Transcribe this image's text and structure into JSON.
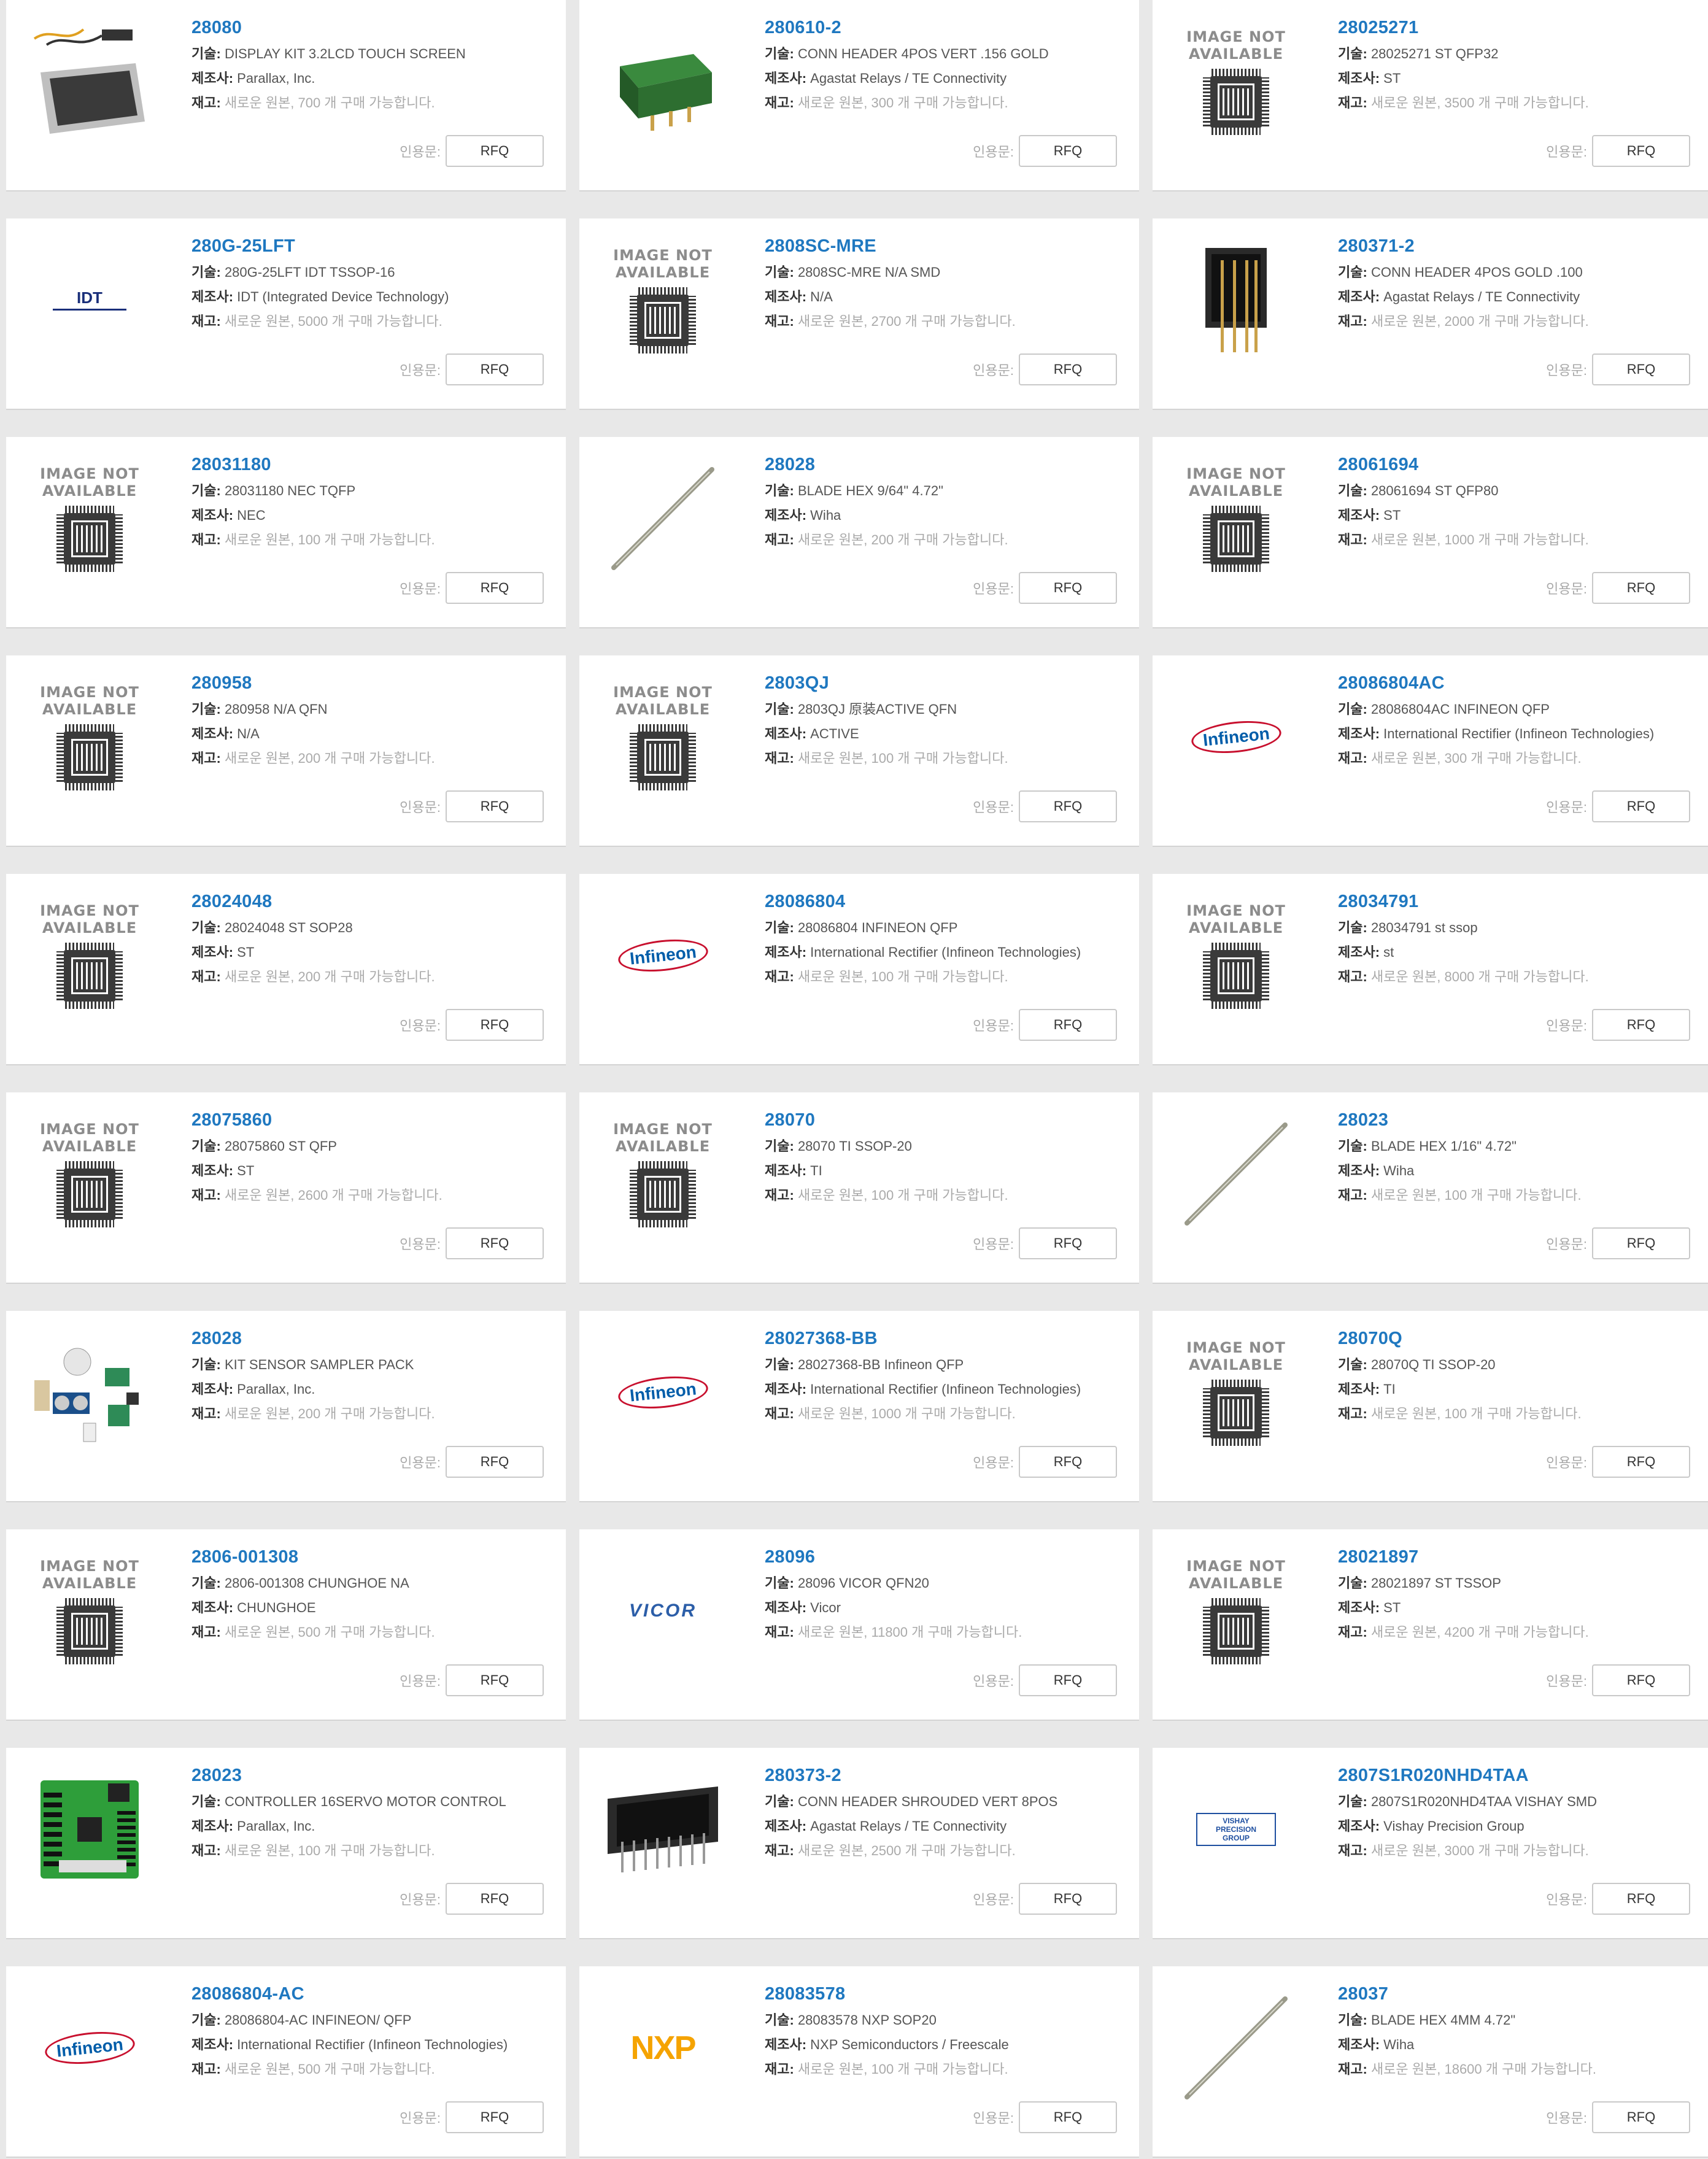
{
  "labels": {
    "desc": "기술:",
    "mfr": "제조사:",
    "stock": "재고:",
    "quote": "인용문:",
    "rfq": "RFQ",
    "na_top": "IMAGE NOT",
    "na_bottom": "AVAILABLE"
  },
  "products": [
    {
      "pn": "28080",
      "desc": "DISPLAY KIT 3.2LCD TOUCH SCREEN",
      "mfr": "Parallax, Inc.",
      "stock": "새로운 원본, 700 개 구매 가능합니다.",
      "thumb": "lcd-kit"
    },
    {
      "pn": "280610-2",
      "desc": "CONN HEADER 4POS VERT .156 GOLD",
      "mfr": "Agastat Relays / TE Connectivity",
      "stock": "새로운 원본, 300 개 구매 가능합니다.",
      "thumb": "green-header"
    },
    {
      "pn": "28025271",
      "desc": "28025271 ST QFP32",
      "mfr": "ST",
      "stock": "새로운 원본, 3500 개 구매 가능합니다.",
      "thumb": "na"
    },
    {
      "pn": "280G-25LFT",
      "desc": "280G-25LFT IDT TSSOP-16",
      "mfr": "IDT (Integrated Device Technology)",
      "stock": "새로운 원본, 5000 개 구매 가능합니다.",
      "thumb": "idt",
      "brand": "IDT"
    },
    {
      "pn": "2808SC-MRE",
      "desc": "2808SC-MRE N/A SMD",
      "mfr": "N/A",
      "stock": "새로운 원본, 2700 개 구매 가능합니다.",
      "thumb": "na"
    },
    {
      "pn": "280371-2",
      "desc": "CONN HEADER 4POS GOLD .100",
      "mfr": "Agastat Relays / TE Connectivity",
      "stock": "새로운 원본, 2000 개 구매 가능합니다.",
      "thumb": "black-header"
    },
    {
      "pn": "28031180",
      "desc": "28031180 NEC TQFP",
      "mfr": "NEC",
      "stock": "새로운 원본, 100 개 구매 가능합니다.",
      "thumb": "na"
    },
    {
      "pn": "28028",
      "desc": "BLADE HEX 9/64\" 4.72\"",
      "mfr": "Wiha",
      "stock": "새로운 원본, 200 개 구매 가능합니다.",
      "thumb": "blade"
    },
    {
      "pn": "28061694",
      "desc": "28061694 ST QFP80",
      "mfr": "ST",
      "stock": "새로운 원본, 1000 개 구매 가능합니다.",
      "thumb": "na"
    },
    {
      "pn": "280958",
      "desc": "280958 N/A QFN",
      "mfr": "N/A",
      "stock": "새로운 원본, 200 개 구매 가능합니다.",
      "thumb": "na"
    },
    {
      "pn": "2803QJ",
      "desc": "2803QJ 原装ACTIVE QFN",
      "mfr": "ACTIVE",
      "stock": "새로운 원본, 100 개 구매 가능합니다.",
      "thumb": "na"
    },
    {
      "pn": "28086804AC",
      "desc": "28086804AC INFINEON QFP",
      "mfr": "International Rectifier (Infineon Technologies)",
      "stock": "새로운 원본, 300 개 구매 가능합니다.",
      "thumb": "infineon",
      "brand": "Infineon"
    },
    {
      "pn": "28024048",
      "desc": "28024048 ST SOP28",
      "mfr": "ST",
      "stock": "새로운 원본, 200 개 구매 가능합니다.",
      "thumb": "na"
    },
    {
      "pn": "28086804",
      "desc": "28086804 INFINEON QFP",
      "mfr": "International Rectifier (Infineon Technologies)",
      "stock": "새로운 원본, 100 개 구매 가능합니다.",
      "thumb": "infineon",
      "brand": "Infineon"
    },
    {
      "pn": "28034791",
      "desc": "28034791 st ssop",
      "mfr": "st",
      "stock": "새로운 원본, 8000 개 구매 가능합니다.",
      "thumb": "na"
    },
    {
      "pn": "28075860",
      "desc": "28075860 ST QFP",
      "mfr": "ST",
      "stock": "새로운 원본, 2600 개 구매 가능합니다.",
      "thumb": "na"
    },
    {
      "pn": "28070",
      "desc": "28070 TI SSOP-20",
      "mfr": "TI",
      "stock": "새로운 원본, 100 개 구매 가능합니다.",
      "thumb": "na"
    },
    {
      "pn": "28023",
      "desc": "BLADE HEX 1/16\" 4.72\"",
      "mfr": "Wiha",
      "stock": "새로운 원본, 100 개 구매 가능합니다.",
      "thumb": "blade"
    },
    {
      "pn": "28028",
      "desc": "KIT SENSOR SAMPLER PACK",
      "mfr": "Parallax, Inc.",
      "stock": "새로운 원본, 200 개 구매 가능합니다.",
      "thumb": "sensor-kit"
    },
    {
      "pn": "28027368-BB",
      "desc": "28027368-BB Infineon QFP",
      "mfr": "International Rectifier (Infineon Technologies)",
      "stock": "새로운 원본, 1000 개 구매 가능합니다.",
      "thumb": "infineon",
      "brand": "Infineon"
    },
    {
      "pn": "28070Q",
      "desc": "28070Q TI SSOP-20",
      "mfr": "TI",
      "stock": "새로운 원본, 100 개 구매 가능합니다.",
      "thumb": "na"
    },
    {
      "pn": "2806-001308",
      "desc": "2806-001308 CHUNGHOE NA",
      "mfr": "CHUNGHOE",
      "stock": "새로운 원본, 500 개 구매 가능합니다.",
      "thumb": "na"
    },
    {
      "pn": "28096",
      "desc": "28096 VICOR QFN20",
      "mfr": "Vicor",
      "stock": "새로운 원본, 11800 개 구매 가능합니다.",
      "thumb": "vicor",
      "brand": "VICOR"
    },
    {
      "pn": "28021897",
      "desc": "28021897 ST TSSOP",
      "mfr": "ST",
      "stock": "새로운 원본, 4200 개 구매 가능합니다.",
      "thumb": "na"
    },
    {
      "pn": "28023",
      "desc": "CONTROLLER 16SERVO MOTOR CONTROL",
      "mfr": "Parallax, Inc.",
      "stock": "새로운 원본, 100 개 구매 가능합니다.",
      "thumb": "pcb"
    },
    {
      "pn": "280373-2",
      "desc": "CONN HEADER SHROUDED VERT 8POS",
      "mfr": "Agastat Relays / TE Connectivity",
      "stock": "새로운 원본, 2500 개 구매 가능합니다.",
      "thumb": "shrouded-header"
    },
    {
      "pn": "2807S1R020NHD4TAA",
      "desc": "2807S1R020NHD4TAA VISHAY SMD",
      "mfr": "Vishay Precision Group",
      "stock": "새로운 원본, 3000 개 구매 가능합니다.",
      "thumb": "vishay",
      "brand": "VISHAY PRECISION GROUP"
    },
    {
      "pn": "28086804-AC",
      "desc": "28086804-AC INFINEON/ QFP",
      "mfr": "International Rectifier (Infineon Technologies)",
      "stock": "새로운 원본, 500 개 구매 가능합니다.",
      "thumb": "infineon",
      "brand": "Infineon"
    },
    {
      "pn": "28083578",
      "desc": "28083578 NXP SOP20",
      "mfr": "NXP Semiconductors / Freescale",
      "stock": "새로운 원본, 100 개 구매 가능합니다.",
      "thumb": "nxp",
      "brand": "NXP"
    },
    {
      "pn": "28037",
      "desc": "BLADE HEX 4MM 4.72\"",
      "mfr": "Wiha",
      "stock": "새로운 원본, 18600 개 구매 가능합니다.",
      "thumb": "blade"
    }
  ]
}
